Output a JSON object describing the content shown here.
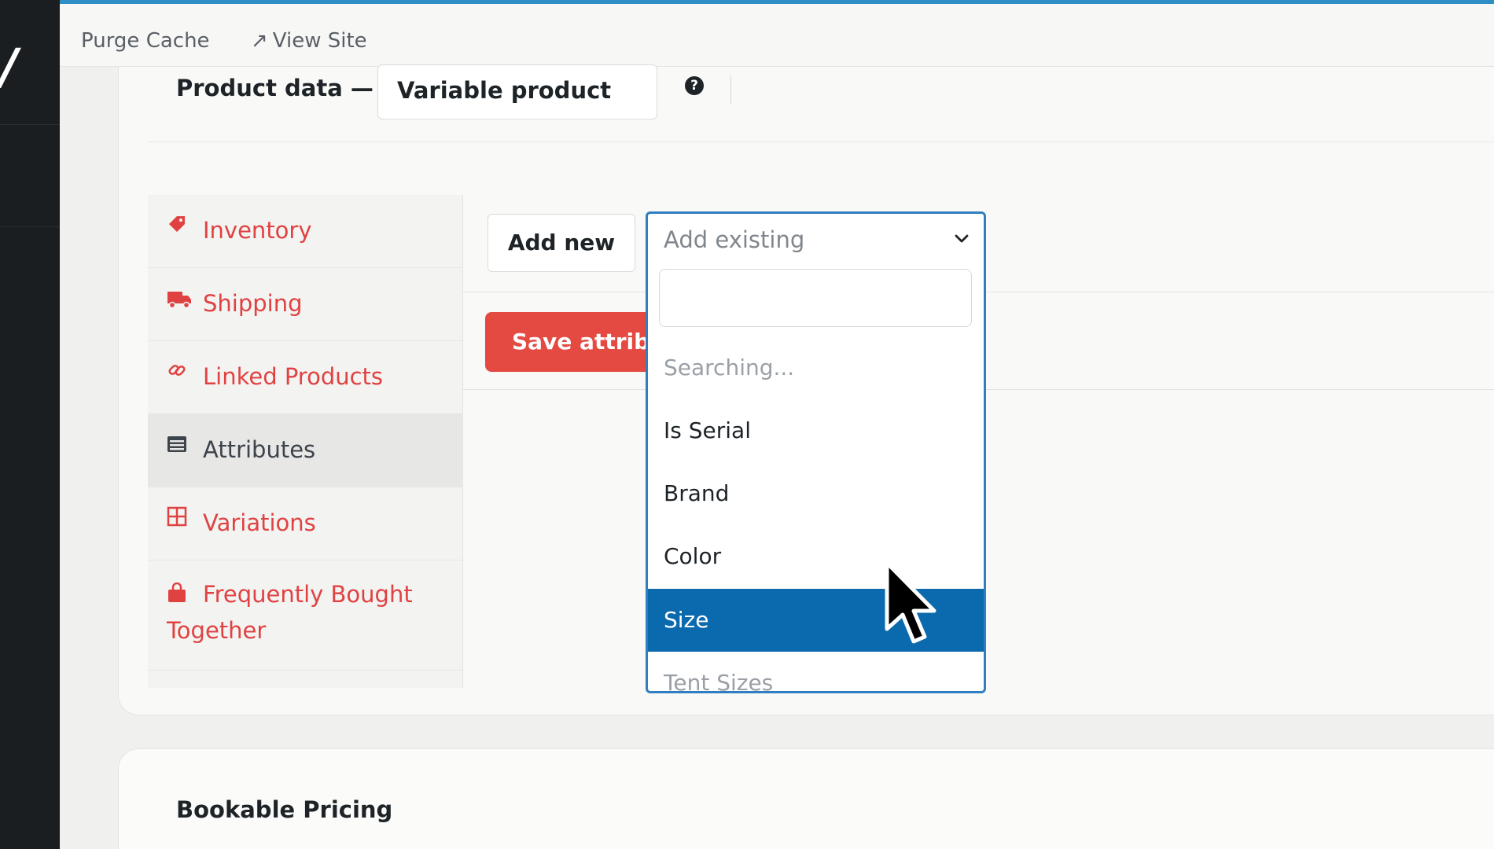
{
  "topbar": {
    "purge_cache": "Purge Cache",
    "view_site": "View Site"
  },
  "product_data": {
    "title": "Product data —",
    "type_value": "Variable product",
    "help": "?"
  },
  "tabs": [
    {
      "label": "Inventory",
      "icon": "tag-icon",
      "active": false
    },
    {
      "label": "Shipping",
      "icon": "truck-icon",
      "active": false
    },
    {
      "label": "Linked Products",
      "icon": "link-icon",
      "active": false
    },
    {
      "label": "Attributes",
      "icon": "list-icon",
      "active": true
    },
    {
      "label": "Variations",
      "icon": "grid-icon",
      "active": false
    },
    {
      "label": "Frequently Bought Together",
      "icon": "bag-icon",
      "active": false
    }
  ],
  "attributes_panel": {
    "add_new": "Add new",
    "save": "Save attributes",
    "dropdown": {
      "placeholder": "Add existing",
      "search_value": "",
      "status": "Searching...",
      "options": [
        "Is Serial",
        "Brand",
        "Color",
        "Size",
        "Tent Sizes"
      ],
      "highlighted": "Size"
    }
  },
  "bookable_pricing": {
    "title": "Bookable Pricing"
  },
  "colors": {
    "accent_red": "#e04242",
    "highlight_blue": "#0b6aad",
    "focus_border": "#2f7fc0"
  }
}
